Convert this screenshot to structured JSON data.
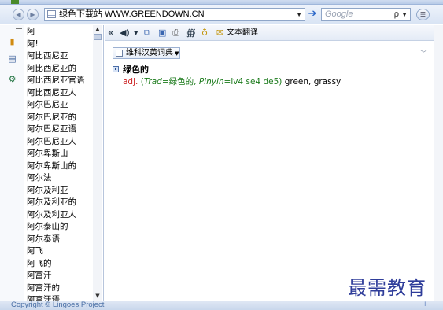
{
  "address_bar": {
    "url": "绿色下载站 WWW.GREENDOWN.CN",
    "search_placeholder": "Google",
    "back_icon": "back-arrow-icon",
    "forward_icon": "forward-arrow-icon",
    "go_icon": "go-arrow-icon"
  },
  "word_list": {
    "items": [
      "阿",
      "阿!",
      "阿比西尼亚",
      "阿比西尼亚的",
      "阿比西尼亚官语",
      "阿比西尼亚人",
      "阿尔巴尼亚",
      "阿尔巴尼亚的",
      "阿尔巴尼亚语",
      "阿尔巴尼亚人",
      "阿尔卑斯山",
      "阿尔卑斯山的",
      "阿尔法",
      "阿尔及利亚",
      "阿尔及利亚的",
      "阿尔及利亚人",
      "阿尔泰山的",
      "阿尔泰语",
      "阿飞",
      "阿飞的",
      "阿富汗",
      "阿富汗的",
      "阿富汗语"
    ]
  },
  "toolbar": {
    "translate_label": "文本翻译"
  },
  "dictionary": {
    "tab_label": "维科汉英词典",
    "headword": "绿色的",
    "pos": "adj.",
    "trad_label": "Trad",
    "trad_value": "绿色的",
    "pinyin_label": "Pinyin",
    "pinyin_value": "lv4 se4 de5",
    "gloss": "green, grassy"
  },
  "status": {
    "copyright": "Copyright © Lingoes Project"
  },
  "watermark": "最需教育"
}
